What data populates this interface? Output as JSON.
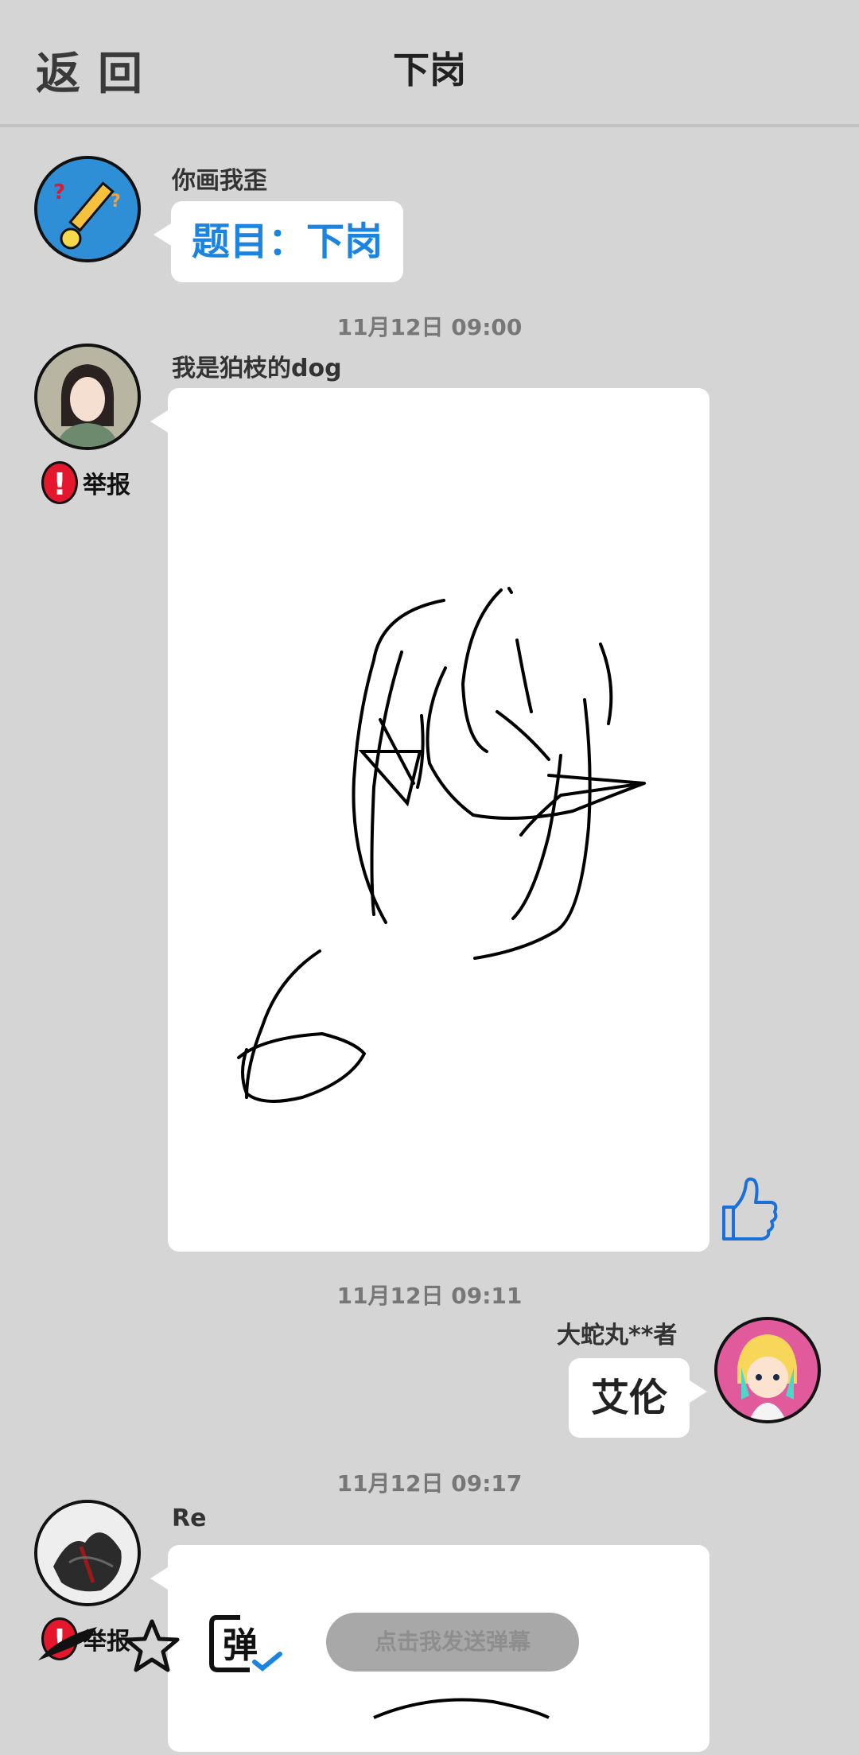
{
  "header": {
    "back_label": "返回",
    "title": "下岗"
  },
  "messages": [
    {
      "user": "你画我歪",
      "text": "题目：下岗"
    },
    {
      "timestamp": "11月12日  09:00",
      "user": "我是狛枝的dog",
      "report": "举报"
    },
    {
      "timestamp": "11月12日  09:11",
      "user": "大蛇丸**者",
      "text": "艾伦"
    },
    {
      "timestamp": "11月12日  09:17",
      "user": "Re",
      "report": "举报"
    }
  ],
  "toolbar": {
    "danmu_placeholder": "点击我发送弹幕",
    "danmu_icon_char": "弹"
  },
  "colors": {
    "accent": "#1a84e0",
    "report": "#e4172c",
    "background": "#d5d5d5"
  },
  "icons": [
    "arrow-left-icon",
    "star-icon",
    "danmu-icon",
    "thumbs-up-icon",
    "report-icon"
  ]
}
